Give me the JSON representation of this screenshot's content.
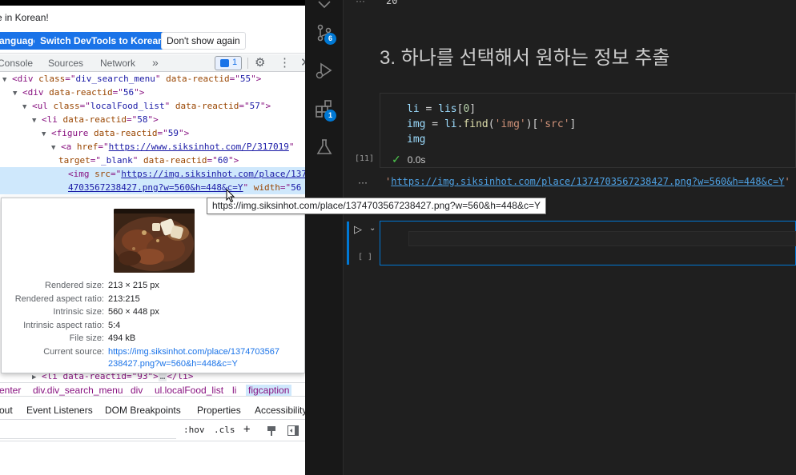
{
  "devtools": {
    "notice": {
      "text": "e in Korean!",
      "btn_language": "anguage",
      "btn_switch": "Switch DevTools to Korean",
      "btn_dont_show": "Don't show again"
    },
    "tabs": {
      "console": "Console",
      "sources": "Sources",
      "network": "Network",
      "more": "»",
      "issues_count": "1"
    },
    "dom": {
      "l1": {
        "tag": "<div ",
        "attr": "class",
        "eq": "=\"",
        "val": "div_search_menu",
        "mid": "\" ",
        "attr2": "data-reactid",
        "eq2": "=\"",
        "val2": "55",
        "end": "\">"
      },
      "l2": {
        "tag": "<div ",
        "attr": "data-reactid",
        "eq": "=\"",
        "val": "56",
        "end": "\">"
      },
      "l3": {
        "tag": "<ul ",
        "attr": "class",
        "eq": "=\"",
        "val": "localFood_list",
        "mid": "\" ",
        "attr2": "data-reactid",
        "eq2": "=\"",
        "val2": "57",
        "end": "\">"
      },
      "l4": {
        "tag": "<li ",
        "attr": "data-reactid",
        "eq": "=\"",
        "val": "58",
        "end": "\">"
      },
      "l5": {
        "tag": "<figure ",
        "attr": "data-reactid",
        "eq": "=\"",
        "val": "59",
        "end": "\">"
      },
      "l6": {
        "tag": "<a ",
        "attr": "href",
        "eq": "=\"",
        "link": "https://www.siksinhot.com/P/317019",
        "end": "\""
      },
      "l7": {
        "attr": "target",
        "eq": "=\"",
        "val": "_blank",
        "mid": "\" ",
        "attr2": "data-reactid",
        "eq2": "=\"",
        "val2": "60",
        "end": "\">"
      },
      "l8": {
        "tag": "<img ",
        "attr": "src",
        "eq": "=\"",
        "link": "https://img.siksinhot.com/place/137"
      },
      "l9": {
        "link": "4703567238427.png?w=560&h=448&c=Y",
        "mid": "\" ",
        "attr2": "width",
        "eq2": "=\"",
        "val2": "56"
      },
      "l10": {
        "text": "<li data-reactid=\"93\">",
        "ell": "…",
        "close": "</li>"
      }
    },
    "image_info": {
      "rendered_size_label": "Rendered size:",
      "rendered_size": "213 × 215 px",
      "rendered_aspect_label": "Rendered aspect ratio:",
      "rendered_aspect": "213:215",
      "intrinsic_size_label": "Intrinsic size:",
      "intrinsic_size": "560 × 448 px",
      "intrinsic_aspect_label": "Intrinsic aspect ratio:",
      "intrinsic_aspect": "5:4",
      "file_size_label": "File size:",
      "file_size": "494 kB",
      "current_source_label": "Current source:",
      "current_source_1": "https://img.siksinhot.com/place/1374703567",
      "current_source_2": "238427.png?w=560&h=448&c=Y"
    },
    "breadcrumb": [
      "enter",
      "div.div_search_menu",
      "div",
      "ul.localFood_list",
      "li",
      "figcaption"
    ],
    "subtabs": [
      "out",
      "Event Listeners",
      "DOM Breakpoints",
      "Properties",
      "Accessibility"
    ],
    "filter": {
      "hov": ":hov",
      "cls": ".cls",
      "plus": "+"
    }
  },
  "vscode": {
    "badges": {
      "source_control": "6",
      "extensions": "1"
    },
    "top_dots": "···",
    "top_output": "20",
    "markdown_heading": "3. 하나를 선택해서 원하는 정보 추출",
    "code": {
      "line1": {
        "var": "li",
        "op": " = ",
        "obj": "lis",
        "open": "[",
        "num": "0",
        "close": "]"
      },
      "line2": {
        "var": "img",
        "op": " = ",
        "obj": "li",
        "dot": ".",
        "fn": "find",
        "p1": "(",
        "s1": "'img'",
        "p2": ")[",
        "s2": "'src'",
        "p3": "]"
      },
      "line3": {
        "var": "img"
      }
    },
    "exec_count": "[11]",
    "exec_time": "0.0s",
    "output_dots": "···",
    "output": {
      "q1": "'",
      "link": "https://img.siksinhot.com/place/1374703567238427.png?w=560&h=448&c=Y",
      "q2": "'"
    },
    "hover_tooltip": "https://img.siksinhot.com/place/1374703567238427.png?w=560&h=448&c=Y",
    "empty_cell_count": "[ ]"
  }
}
